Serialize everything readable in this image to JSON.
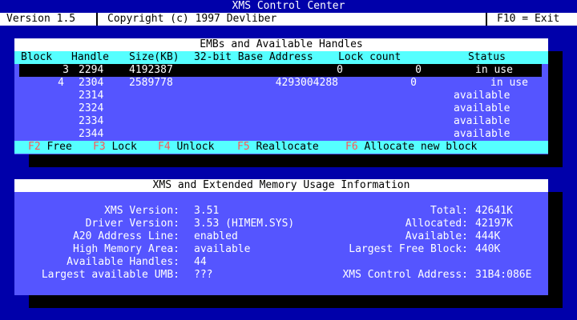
{
  "title": "XMS Control Center",
  "menubar": {
    "version": "Version 1.5",
    "copyright": "Copyright (c) 1997 Devliber",
    "exit": "F10 = Exit"
  },
  "emb_panel": {
    "title": "EMBs and Available Handles",
    "columns": [
      "Block",
      "Handle",
      "Size(KB)",
      "32-bit Base Address",
      "Lock count",
      "Status"
    ],
    "rows": [
      {
        "block": "3",
        "handle": "2294",
        "size": "4192387",
        "base": "0",
        "lock": "0",
        "status": "in use",
        "selected": true
      },
      {
        "block": "4",
        "handle": "2304",
        "size": "2589778",
        "base": "4293004288",
        "lock": "0",
        "status": "in use",
        "selected": false
      },
      {
        "block": "",
        "handle": "2314",
        "size": "",
        "base": "",
        "lock": "",
        "status": "available",
        "selected": false
      },
      {
        "block": "",
        "handle": "2324",
        "size": "",
        "base": "",
        "lock": "",
        "status": "available",
        "selected": false
      },
      {
        "block": "",
        "handle": "2334",
        "size": "",
        "base": "",
        "lock": "",
        "status": "available",
        "selected": false
      },
      {
        "block": "",
        "handle": "2344",
        "size": "",
        "base": "",
        "lock": "",
        "status": "available",
        "selected": false
      }
    ],
    "fkeys": [
      {
        "key": "F2",
        "label": "Free"
      },
      {
        "key": "F3",
        "label": "Lock"
      },
      {
        "key": "F4",
        "label": "Unlock"
      },
      {
        "key": "F5",
        "label": "Reallocate"
      },
      {
        "key": "F6",
        "label": "Allocate new block"
      }
    ]
  },
  "xms_panel": {
    "title": "XMS and Extended Memory Usage Information",
    "left": [
      {
        "label": "XMS Version:",
        "value": "3.51"
      },
      {
        "label": "Driver Version:",
        "value": "3.53 (HIMEM.SYS)"
      },
      {
        "label": "A20 Address Line:",
        "value": "enabled"
      },
      {
        "label": "High Memory Area:",
        "value": "available"
      },
      {
        "label": "Available Handles:",
        "value": "44"
      },
      {
        "label": "Largest available UMB:",
        "value": "???"
      }
    ],
    "right": [
      {
        "label": "Total:",
        "value": "42641K"
      },
      {
        "label": "Allocated:",
        "value": "42197K"
      },
      {
        "label": "Available:",
        "value": "444K"
      },
      {
        "label": "Largest Free Block:",
        "value": "440K"
      },
      {
        "label": "",
        "value": ""
      },
      {
        "label": "XMS Control Address:",
        "value": "31B4:086E"
      }
    ]
  },
  "colors": {
    "background": "#0000aa",
    "panel": "#5555ff",
    "header_bar": "#55ffff",
    "function_key": "#ff5555",
    "shadow": "#000000"
  }
}
